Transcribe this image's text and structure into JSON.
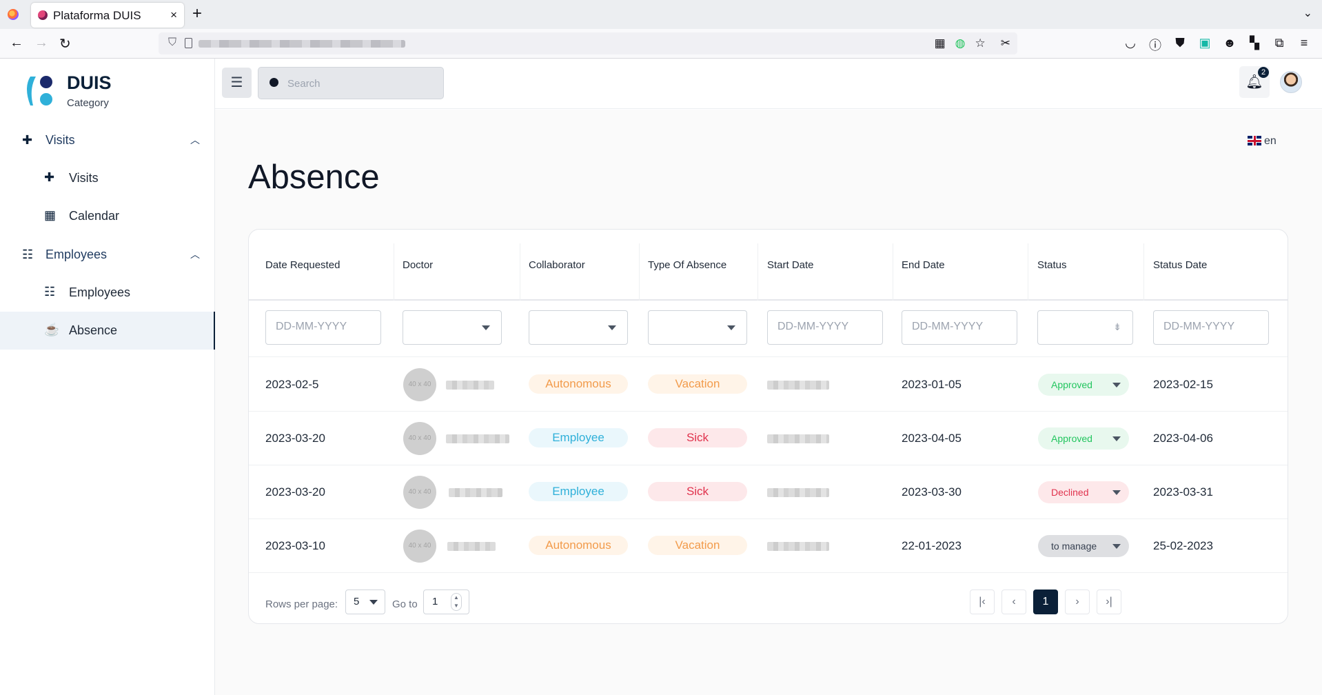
{
  "browser": {
    "tab_title": "Plataforma DUIS",
    "tab_close": "×",
    "new_tab": "+"
  },
  "brand": {
    "name": "DUIS",
    "subtitle": "Category"
  },
  "sidebar": {
    "groups": [
      {
        "label": "Visits",
        "items": [
          {
            "label": "Visits"
          },
          {
            "label": "Calendar"
          }
        ]
      },
      {
        "label": "Employees",
        "items": [
          {
            "label": "Employees"
          },
          {
            "label": "Absence",
            "active": true
          }
        ]
      }
    ]
  },
  "header": {
    "search_placeholder": "Search",
    "notification_count": "2"
  },
  "language": {
    "code": "en"
  },
  "page": {
    "title": "Absence"
  },
  "table": {
    "columns": [
      "Date Requested",
      "Doctor",
      "Collaborator",
      "Type Of Absence",
      "Start Date",
      "End Date",
      "Status",
      "Status Date"
    ],
    "date_placeholder": "DD-MM-YYYY",
    "avatar_placeholder": "40 x 40",
    "rows": [
      {
        "date_requested": "2023-02-5",
        "collaborator": "Autonomous",
        "type": "Vacation",
        "end_date": "2023-01-05",
        "status": "Approved",
        "status_date": "2023-02-15"
      },
      {
        "date_requested": "2023-03-20",
        "collaborator": "Employee",
        "type": "Sick",
        "end_date": "2023-04-05",
        "status": "Approved",
        "status_date": "2023-04-06"
      },
      {
        "date_requested": "2023-03-20",
        "collaborator": "Employee",
        "type": "Sick",
        "end_date": "2023-03-30",
        "status": "Declined",
        "status_date": "2023-03-31"
      },
      {
        "date_requested": "2023-03-10",
        "collaborator": "Autonomous",
        "type": "Vacation",
        "end_date": "22-01-2023",
        "status": "to manage",
        "status_date": "25-02-2023"
      }
    ]
  },
  "pagination": {
    "rows_per_page_label": "Rows per page:",
    "rows_per_page": "5",
    "goto_label": "Go to",
    "goto_value": "1",
    "current_page": "1"
  },
  "colors": {
    "brand_navy": "#0b2038",
    "approved": "#22c55e",
    "declined": "#e0324d",
    "autonomous": "#f29b4b",
    "employee": "#2fb0d9"
  }
}
